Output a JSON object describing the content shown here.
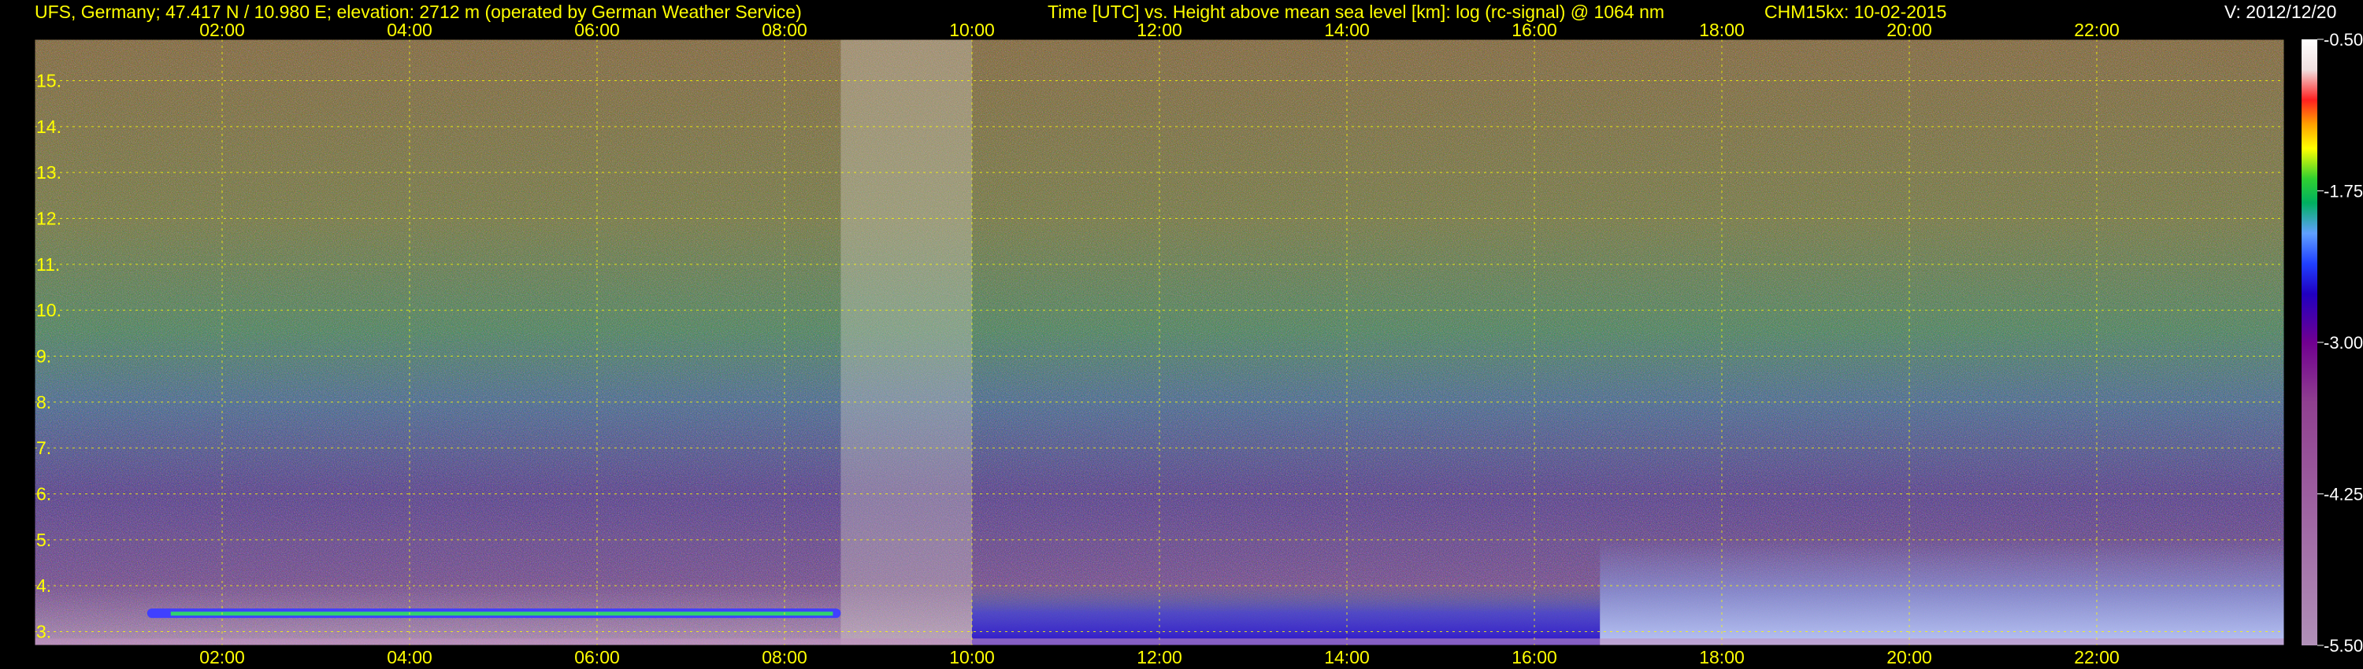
{
  "header": {
    "station": "UFS, Germany; 47.417 N / 10.980 E; elevation: 2712 m  (operated by German Weather Service)",
    "axes_desc": "Time [UTC] vs. Height above mean sea level [km]: log (rc-signal) @ 1064 nm",
    "instrument": "CHM15kx: 10-02-2015",
    "version": "V: 2012/12/20"
  },
  "colors": {
    "text": "#ffff00",
    "header_right": "#ffffff",
    "grid": "#ffff00",
    "background": "#000000"
  },
  "chart_data": {
    "type": "heatmap",
    "title": "",
    "xlabel": "Time [UTC]",
    "ylabel": "Height above mean sea level [km]",
    "quantity": "log (rc-signal) @ 1064 nm",
    "x_unit": "UTC hours",
    "x_range": [
      0,
      24
    ],
    "x_ticks": [
      "02:00",
      "04:00",
      "06:00",
      "08:00",
      "10:00",
      "12:00",
      "14:00",
      "16:00",
      "18:00",
      "20:00",
      "22:00"
    ],
    "x_tick_values": [
      2,
      4,
      6,
      8,
      10,
      12,
      14,
      16,
      18,
      20,
      22
    ],
    "y_range": [
      2.7,
      15.9
    ],
    "y_ticks": [
      "3.",
      "4.",
      "5.",
      "6.",
      "7.",
      "8.",
      "9.",
      "10.",
      "11.",
      "12.",
      "13.",
      "14.",
      "15."
    ],
    "y_tick_values": [
      3,
      4,
      5,
      6,
      7,
      8,
      9,
      10,
      11,
      12,
      13,
      14,
      15
    ],
    "grid": true,
    "colorbar": {
      "range": [
        -5.5,
        -0.5
      ],
      "ticks": [
        "-0.50",
        "-1.75",
        "-3.00",
        "-4.25",
        "-5.50"
      ],
      "tick_values": [
        -0.5,
        -1.75,
        -3.0,
        -4.25,
        -5.5
      ]
    },
    "features": [
      {
        "name": "cloud layer",
        "t_start": 1.2,
        "t_end": 8.6,
        "height_km": 3.4
      },
      {
        "name": "noisy signal",
        "t_start": 8.6,
        "t_end": 10.0
      },
      {
        "name": "high backscatter",
        "t_start": 10.0,
        "t_end": 16.7,
        "height_km_top": 4.0
      },
      {
        "name": "diffuse layer",
        "t_start": 16.7,
        "t_end": 24.0,
        "height_km_top": 5.0
      }
    ]
  }
}
